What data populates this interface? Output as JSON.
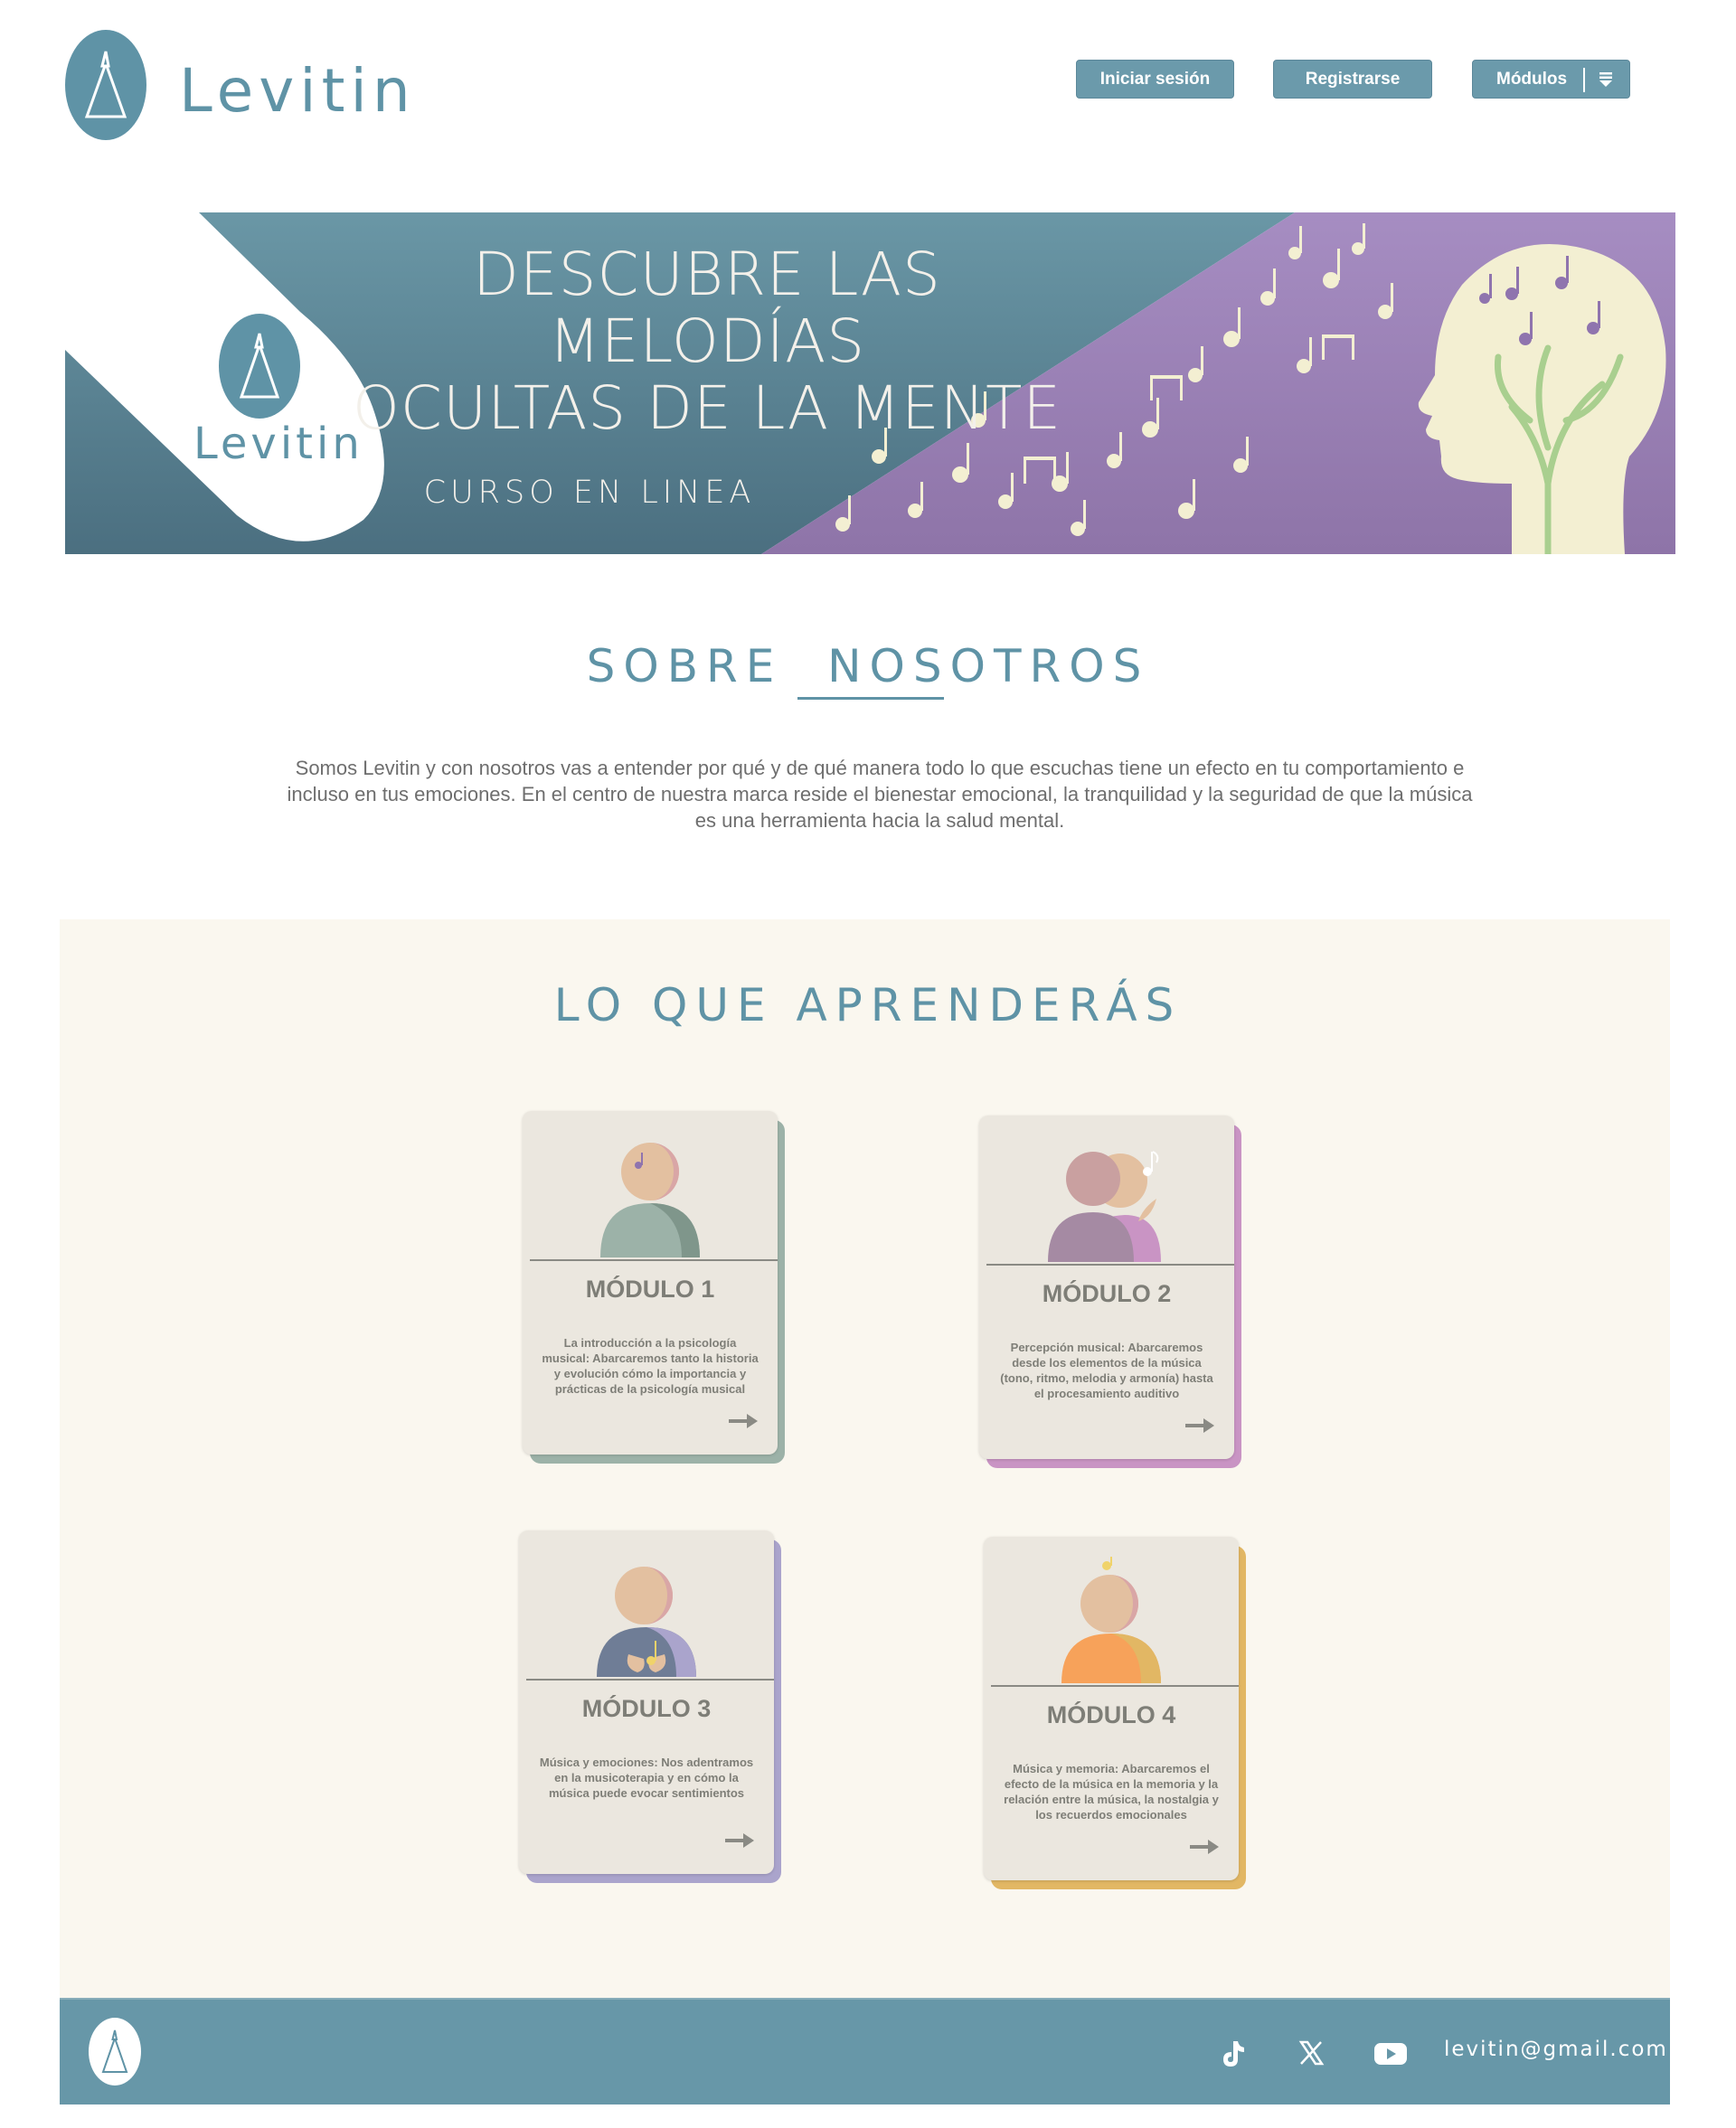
{
  "header": {
    "brand": "Levitin",
    "login_label": "Iniciar sesión",
    "register_label": "Registrarse",
    "modules_label": "Módulos"
  },
  "banner": {
    "title_line1": "DESCUBRE LAS MELODÍAS",
    "title_line2": "OCULTAS DE LA MENTE",
    "subtitle": "CURSO EN LINEA",
    "brand": "Levitin"
  },
  "about": {
    "title": "SOBRE  NOSOTROS",
    "text": "Somos Levitin y con nosotros vas a entender por qué y de qué manera todo lo que escuchas tiene un efecto en tu comportamiento e incluso en tus emociones. En el centro de nuestra marca reside el bienestar emocional, la tranquilidad y la seguridad de que la música es una herramienta hacia la salud mental."
  },
  "learn": {
    "title": "LO QUE APRENDERÁS",
    "modules": [
      {
        "title": "MÓDULO 1",
        "desc": "La introducción a la psicología musical: Abarcaremos tanto la historia y evolución cómo la importancia y prácticas de la psicología musical",
        "accent": "#9cb2a8"
      },
      {
        "title": "MÓDULO 2",
        "desc": "Percepción musical: Abarcaremos desde los elementos de la música (tono, ritmo, melodia y armonía) hasta el procesamiento auditivo",
        "accent": "#c994c4"
      },
      {
        "title": "MÓDULO 3",
        "desc": "Música y emociones: Nos adentramos en la musicoterapia y en cómo la música puede evocar sentimientos",
        "accent": "#aaa4cc"
      },
      {
        "title": "MÓDULO 4",
        "desc": "Música y memoria: Abarcaremos el efecto de la música en la memoria y la relación entre la música, la nostalgia y los recuerdos emocionales",
        "accent": "#e2b764"
      }
    ]
  },
  "footer": {
    "email": "levitin@gmail.com",
    "icons": [
      "tiktok-icon",
      "x-icon",
      "youtube-icon"
    ]
  },
  "colors": {
    "primary": "#5f93a6",
    "banner_teal": "#5d8594",
    "banner_purple": "#9b84b6",
    "cream": "#faf7ef"
  }
}
